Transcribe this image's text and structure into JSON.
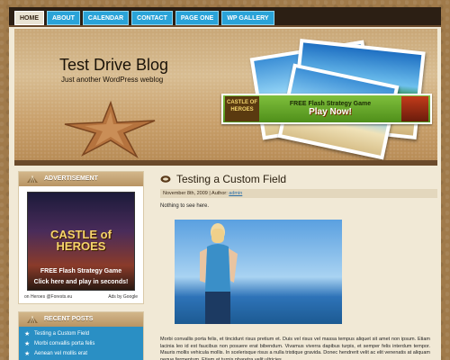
{
  "nav": {
    "items": [
      "HOME",
      "ABOUT",
      "CALENDAR",
      "CONTACT",
      "PAGE ONE",
      "WP GALLERY"
    ],
    "active_index": 0
  },
  "header": {
    "title": "Test Drive Blog",
    "tagline": "Just another WordPress weblog",
    "banner": {
      "logo": "CASTLE OF HEROES",
      "line1": "FREE Flash Strategy Game",
      "line2": "Play Now!"
    }
  },
  "sidebar": {
    "advertisement": {
      "title": "ADVERTISEMENT",
      "castle_text": "CASTLE of HEROES",
      "sub1": "FREE Flash Strategy Game",
      "sub2": "Click here and play in seconds!",
      "footer_left": "on Heroes @Forests.eu",
      "footer_right": "Ads by Google"
    },
    "recent_posts": {
      "title": "RECENT POSTS",
      "items": [
        "Testing a Custom Field",
        "Morbi convallis porta felis",
        "Aenean vel mollis erat"
      ]
    }
  },
  "post": {
    "title": "Testing a Custom Field",
    "date": "November 8th, 2009",
    "author_prefix": "| Author:",
    "author": "admin",
    "intro": "Nothing to see here.",
    "body": "Morbi convallis porta felis, et tincidunt risus pretium et. Duis vel risus vel massa tempus aliquet sit amet non ipsum. Etiam lacinia leo id est faucibus non posuere erat bibendum. Vivamus viverra dapibus turpis, et semper felis interdum tempor. Mauris mollis vehicula mollis. In scelerisque risus a nulla tristique gravida. Donec hendrerit velit ac elit venenatis at aliquam neque fermentum. Etiam at turpis pharetra velit ultricies"
  },
  "colors": {
    "nav_blue": "#2aa3d8",
    "dark_bar": "#2c1f14",
    "link": "#2a6ea8"
  }
}
